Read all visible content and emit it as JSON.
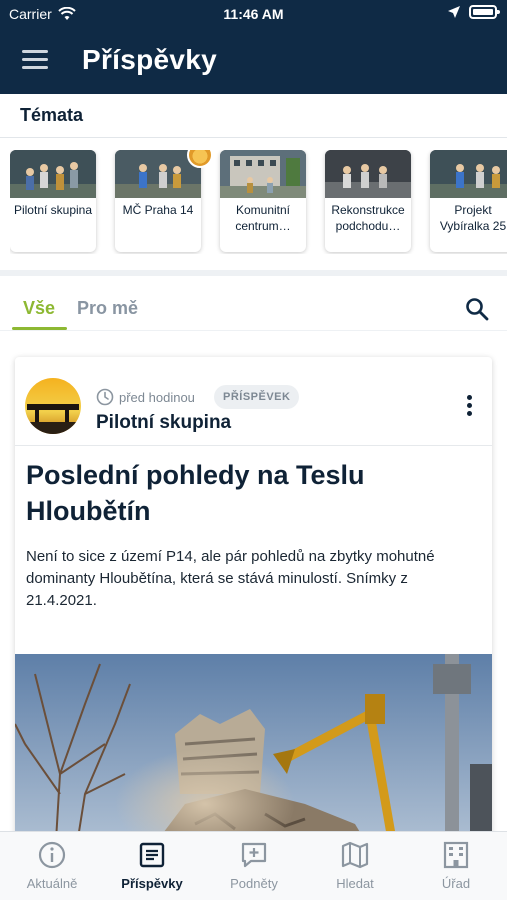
{
  "status": {
    "carrier": "Carrier",
    "time": "11:46 AM"
  },
  "header": {
    "title": "Příspěvky"
  },
  "topics": {
    "label": "Témata",
    "items": [
      {
        "label": "Pilotní skupina"
      },
      {
        "label": "MČ Praha 14"
      },
      {
        "label": "Komunitní centrum…"
      },
      {
        "label": "Rekonstrukce podchodu…"
      },
      {
        "label": "Projekt Vybíralka 25"
      }
    ]
  },
  "tabs": {
    "all": "Vše",
    "mine": "Pro mě"
  },
  "post": {
    "time": "před hodinou",
    "badge": "PŘÍSPĚVEK",
    "author": "Pilotní skupina",
    "title": "Poslední pohledy na Teslu Hloubětín",
    "text": "Není to sice z území P14, ale pár pohledů na zbytky mohutné dominanty Hloubětína, která se stává minulostí. Snímky z 21.4.2021."
  },
  "nav": [
    {
      "label": "Aktuálně",
      "icon": "info-icon"
    },
    {
      "label": "Příspěvky",
      "icon": "article-icon"
    },
    {
      "label": "Podněty",
      "icon": "add-suggestion-icon"
    },
    {
      "label": "Hledat",
      "icon": "map-icon"
    },
    {
      "label": "Úřad",
      "icon": "building-icon"
    }
  ],
  "colors": {
    "header_bg": "#0f2a45",
    "accent": "#8db832",
    "text_dark": "#0f2236"
  }
}
